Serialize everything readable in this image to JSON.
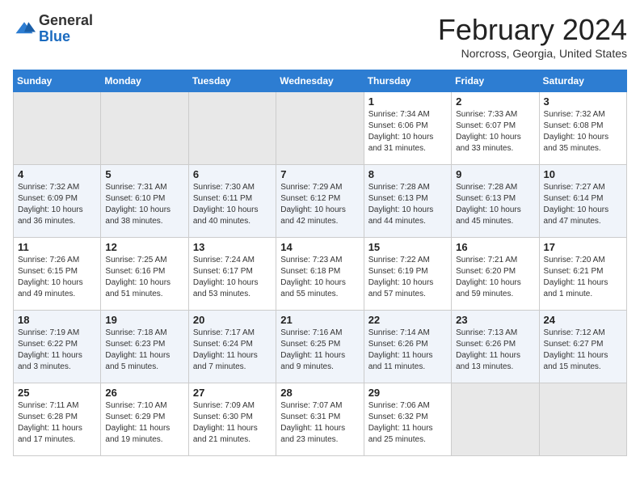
{
  "header": {
    "logo_general": "General",
    "logo_blue": "Blue",
    "month_year": "February 2024",
    "location": "Norcross, Georgia, United States"
  },
  "days_of_week": [
    "Sunday",
    "Monday",
    "Tuesday",
    "Wednesday",
    "Thursday",
    "Friday",
    "Saturday"
  ],
  "weeks": [
    [
      null,
      null,
      null,
      null,
      {
        "day": "1",
        "sunrise": "7:34 AM",
        "sunset": "6:06 PM",
        "daylight": "10 hours and 31 minutes."
      },
      {
        "day": "2",
        "sunrise": "7:33 AM",
        "sunset": "6:07 PM",
        "daylight": "10 hours and 33 minutes."
      },
      {
        "day": "3",
        "sunrise": "7:32 AM",
        "sunset": "6:08 PM",
        "daylight": "10 hours and 35 minutes."
      }
    ],
    [
      {
        "day": "4",
        "sunrise": "7:32 AM",
        "sunset": "6:09 PM",
        "daylight": "10 hours and 36 minutes."
      },
      {
        "day": "5",
        "sunrise": "7:31 AM",
        "sunset": "6:10 PM",
        "daylight": "10 hours and 38 minutes."
      },
      {
        "day": "6",
        "sunrise": "7:30 AM",
        "sunset": "6:11 PM",
        "daylight": "10 hours and 40 minutes."
      },
      {
        "day": "7",
        "sunrise": "7:29 AM",
        "sunset": "6:12 PM",
        "daylight": "10 hours and 42 minutes."
      },
      {
        "day": "8",
        "sunrise": "7:28 AM",
        "sunset": "6:13 PM",
        "daylight": "10 hours and 44 minutes."
      },
      {
        "day": "9",
        "sunrise": "7:28 AM",
        "sunset": "6:13 PM",
        "daylight": "10 hours and 45 minutes."
      },
      {
        "day": "10",
        "sunrise": "7:27 AM",
        "sunset": "6:14 PM",
        "daylight": "10 hours and 47 minutes."
      }
    ],
    [
      {
        "day": "11",
        "sunrise": "7:26 AM",
        "sunset": "6:15 PM",
        "daylight": "10 hours and 49 minutes."
      },
      {
        "day": "12",
        "sunrise": "7:25 AM",
        "sunset": "6:16 PM",
        "daylight": "10 hours and 51 minutes."
      },
      {
        "day": "13",
        "sunrise": "7:24 AM",
        "sunset": "6:17 PM",
        "daylight": "10 hours and 53 minutes."
      },
      {
        "day": "14",
        "sunrise": "7:23 AM",
        "sunset": "6:18 PM",
        "daylight": "10 hours and 55 minutes."
      },
      {
        "day": "15",
        "sunrise": "7:22 AM",
        "sunset": "6:19 PM",
        "daylight": "10 hours and 57 minutes."
      },
      {
        "day": "16",
        "sunrise": "7:21 AM",
        "sunset": "6:20 PM",
        "daylight": "10 hours and 59 minutes."
      },
      {
        "day": "17",
        "sunrise": "7:20 AM",
        "sunset": "6:21 PM",
        "daylight": "11 hours and 1 minute."
      }
    ],
    [
      {
        "day": "18",
        "sunrise": "7:19 AM",
        "sunset": "6:22 PM",
        "daylight": "11 hours and 3 minutes."
      },
      {
        "day": "19",
        "sunrise": "7:18 AM",
        "sunset": "6:23 PM",
        "daylight": "11 hours and 5 minutes."
      },
      {
        "day": "20",
        "sunrise": "7:17 AM",
        "sunset": "6:24 PM",
        "daylight": "11 hours and 7 minutes."
      },
      {
        "day": "21",
        "sunrise": "7:16 AM",
        "sunset": "6:25 PM",
        "daylight": "11 hours and 9 minutes."
      },
      {
        "day": "22",
        "sunrise": "7:14 AM",
        "sunset": "6:26 PM",
        "daylight": "11 hours and 11 minutes."
      },
      {
        "day": "23",
        "sunrise": "7:13 AM",
        "sunset": "6:26 PM",
        "daylight": "11 hours and 13 minutes."
      },
      {
        "day": "24",
        "sunrise": "7:12 AM",
        "sunset": "6:27 PM",
        "daylight": "11 hours and 15 minutes."
      }
    ],
    [
      {
        "day": "25",
        "sunrise": "7:11 AM",
        "sunset": "6:28 PM",
        "daylight": "11 hours and 17 minutes."
      },
      {
        "day": "26",
        "sunrise": "7:10 AM",
        "sunset": "6:29 PM",
        "daylight": "11 hours and 19 minutes."
      },
      {
        "day": "27",
        "sunrise": "7:09 AM",
        "sunset": "6:30 PM",
        "daylight": "11 hours and 21 minutes."
      },
      {
        "day": "28",
        "sunrise": "7:07 AM",
        "sunset": "6:31 PM",
        "daylight": "11 hours and 23 minutes."
      },
      {
        "day": "29",
        "sunrise": "7:06 AM",
        "sunset": "6:32 PM",
        "daylight": "11 hours and 25 minutes."
      },
      null,
      null
    ]
  ]
}
